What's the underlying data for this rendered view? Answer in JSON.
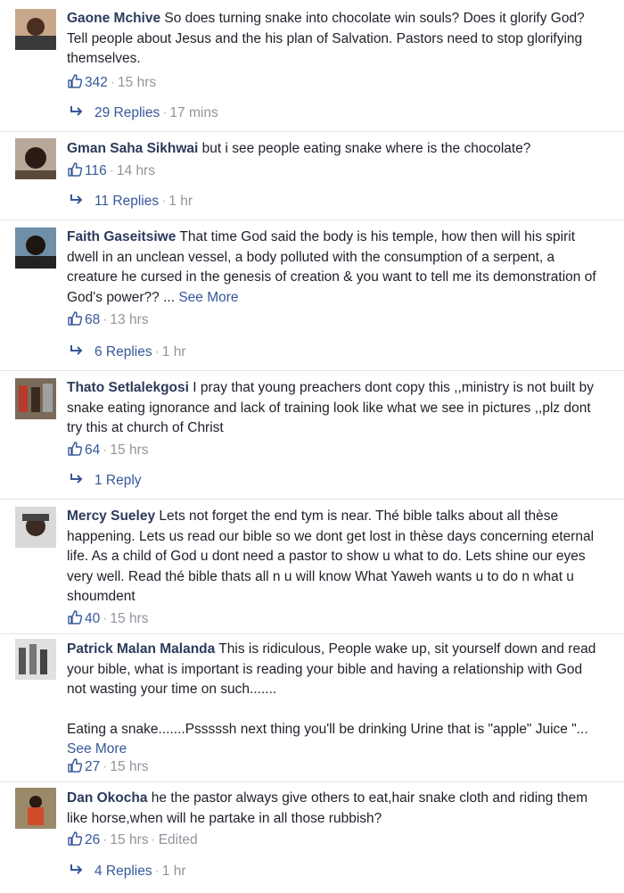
{
  "comments": [
    {
      "author": "Gaone Mchive",
      "paragraphs": [
        "So does turning snake into chocolate win souls? Does it glorify God? Tell people about Jesus and the his plan of Salvation. Pastors need to stop glorifying themselves."
      ],
      "see_more": "",
      "likes": "342",
      "time": "15 hrs",
      "edited": "",
      "replies": "29 Replies",
      "reply_time": "17 mins"
    },
    {
      "author": "Gman Saha Sikhwai",
      "paragraphs": [
        "but i see people eating snake where is the chocolate?"
      ],
      "see_more": "",
      "likes": "116",
      "time": "14 hrs",
      "edited": "",
      "replies": "11 Replies",
      "reply_time": "1 hr"
    },
    {
      "author": "Faith Gaseitsiwe",
      "paragraphs": [
        "That time God said the body is his temple, how then will his spirit dwell in an unclean vessel, a body polluted with the consumption of a serpent, a creature he cursed in the genesis of creation & you want to tell me its demonstration of God's power?? ..."
      ],
      "see_more": "See More",
      "likes": "68",
      "time": "13 hrs",
      "edited": "",
      "replies": "6 Replies",
      "reply_time": "1 hr"
    },
    {
      "author": "Thato Setlalekgosi",
      "paragraphs": [
        "I pray that young preachers dont copy this ,,ministry is not built by snake eating ignorance and lack of training look like what we see in pictures ,,plz dont try this at church of Christ"
      ],
      "see_more": "",
      "likes": "64",
      "time": "15 hrs",
      "edited": "",
      "replies": "1 Reply",
      "reply_time": ""
    },
    {
      "author": "Mercy Sueley",
      "paragraphs": [
        "Lets not forget the end tym is near. Thé bible talks about all thèse happening. Lets us read our bible so we dont get lost in thèse days concerning eternal life. As a child of God u dont need a pastor to show u what to do. Lets shine our eyes very well. Read thé bible thats all n u will know What Yaweh wants u to do n what u shoumdent"
      ],
      "see_more": "",
      "likes": "40",
      "time": "15 hrs",
      "edited": "",
      "replies": "",
      "reply_time": ""
    },
    {
      "author": "Patrick Malan Malanda",
      "paragraphs": [
        "This is ridiculous, People wake up, sit yourself down and read your bible, what is important is reading your bible and having a relationship with God not wasting your time on such.......",
        "Eating a snake.......Psssssh next thing you'll be drinking Urine that is \"apple\" Juice \"..."
      ],
      "see_more": "See More",
      "likes": "27",
      "time": "15 hrs",
      "edited": "",
      "replies": "",
      "reply_time": ""
    },
    {
      "author": "Dan Okocha",
      "paragraphs": [
        "he the pastor always give others to eat,hair snake cloth and riding them like horse,when will he partake in all those rubbish?"
      ],
      "see_more": "",
      "likes": "26",
      "time": "15 hrs",
      "edited": "Edited",
      "replies": "4 Replies",
      "reply_time": "1 hr"
    }
  ]
}
